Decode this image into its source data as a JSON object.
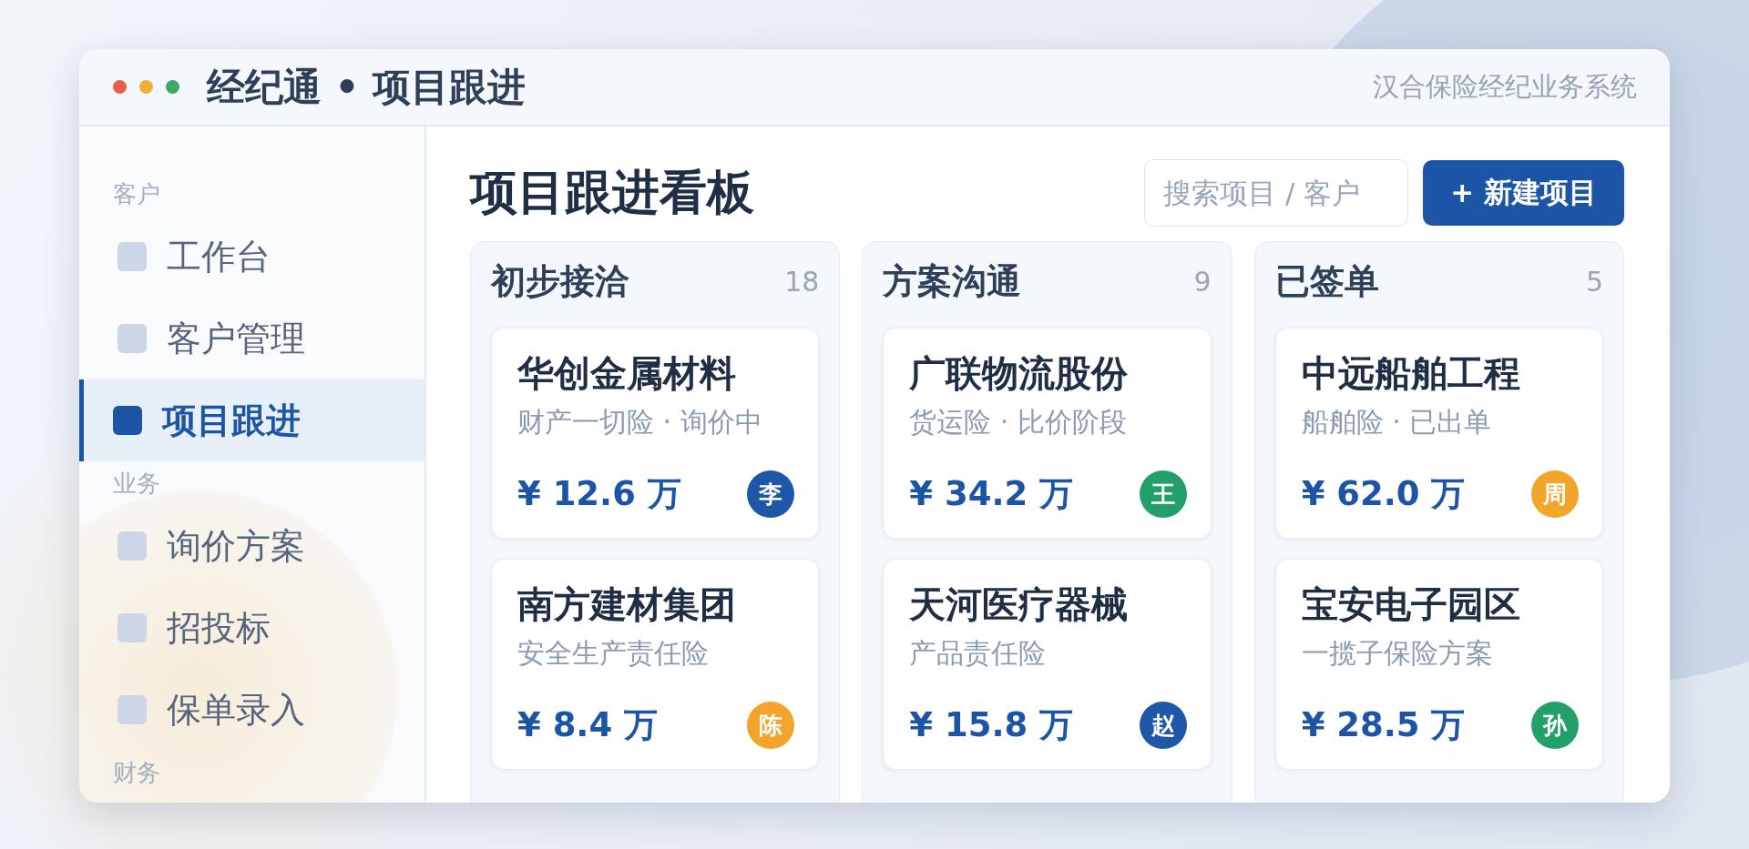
{
  "window": {
    "title": "经纪通 • 项目跟进",
    "subtitle": "汉合保险经纪业务系统"
  },
  "sidebar": {
    "sections": [
      {
        "label": "客户",
        "items": [
          {
            "label": "工作台",
            "selected": false
          },
          {
            "label": "客户管理",
            "selected": false
          },
          {
            "label": "项目跟进",
            "selected": true
          }
        ]
      },
      {
        "label": "业务",
        "items": [
          {
            "label": "询价方案",
            "selected": false
          },
          {
            "label": "招投标",
            "selected": false
          },
          {
            "label": "保单录入",
            "selected": false
          }
        ]
      },
      {
        "label": "财务"
      }
    ]
  },
  "main": {
    "heading": "项目跟进看板",
    "search": {
      "placeholder": "搜索项目 / 客户"
    },
    "new_button": "+ 新建项目"
  },
  "columns": [
    {
      "title": "初步接洽",
      "count": "18",
      "cards": [
        {
          "name": "华创金属材料",
          "detail": "财产一切险 · 询价中",
          "amount": "¥ 12.6 万",
          "owner": "李",
          "color": "#1e56a8"
        },
        {
          "name": "南方建材集团",
          "detail": "安全生产责任险",
          "amount": "¥ 8.4 万",
          "owner": "陈",
          "color": "#f2a52a"
        }
      ]
    },
    {
      "title": "方案沟通",
      "count": "9",
      "cards": [
        {
          "name": "广联物流股份",
          "detail": "货运险 · 比价阶段",
          "amount": "¥ 34.2 万",
          "owner": "王",
          "color": "#23a06a"
        },
        {
          "name": "天河医疗器械",
          "detail": "产品责任险",
          "amount": "¥ 15.8 万",
          "owner": "赵",
          "color": "#1e56a8"
        }
      ]
    },
    {
      "title": "已签单",
      "count": "5",
      "cards": [
        {
          "name": "中远船舶工程",
          "detail": "船舶险 · 已出单",
          "amount": "¥ 62.0 万",
          "owner": "周",
          "color": "#f2a52a"
        },
        {
          "name": "宝安电子园区",
          "detail": "一揽子保险方案",
          "amount": "¥ 28.5 万",
          "owner": "孙",
          "color": "#23a06a"
        }
      ]
    }
  ]
}
